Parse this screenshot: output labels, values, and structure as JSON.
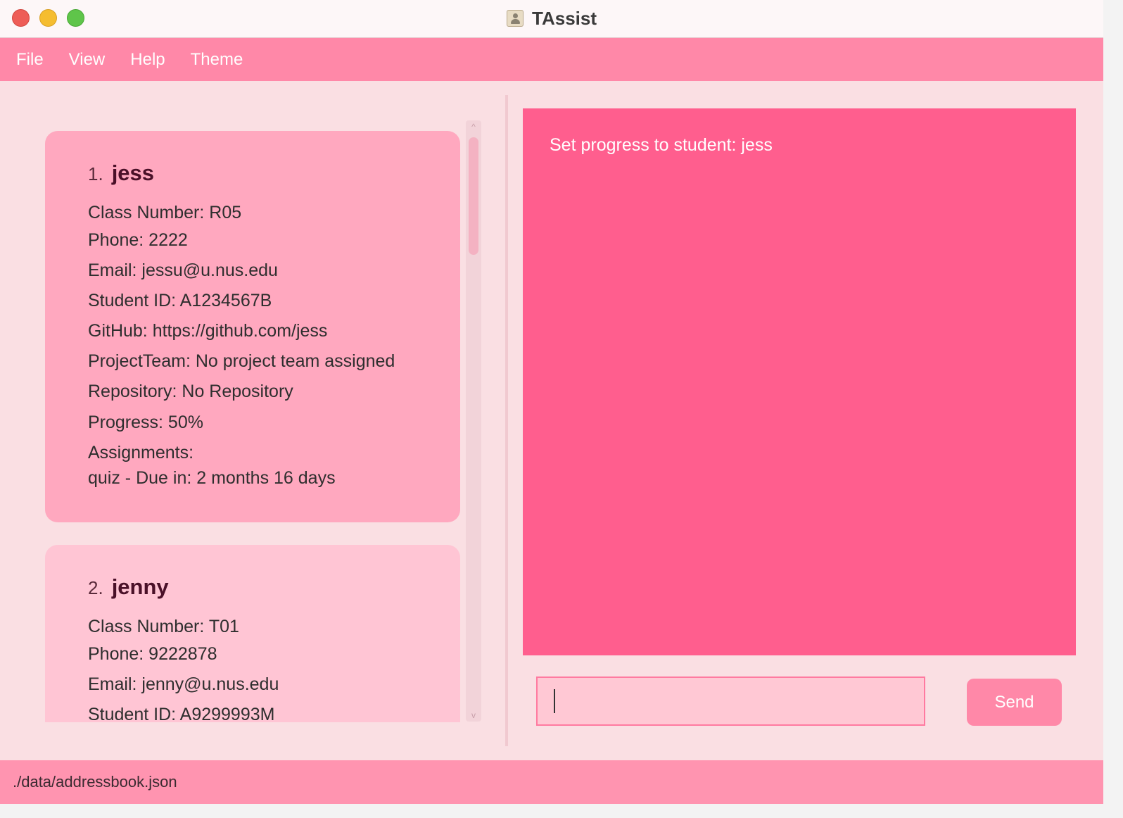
{
  "window": {
    "title": "TAssist"
  },
  "menu": [
    "File",
    "View",
    "Help",
    "Theme"
  ],
  "students": [
    {
      "index": "1.",
      "name": "jess",
      "class_number": "Class Number: R05",
      "phone": "Phone: 2222",
      "email": "Email: jessu@u.nus.edu",
      "student_id": "Student ID: A1234567B",
      "github": "GitHub: https://github.com/jess",
      "project_team": "ProjectTeam: No project team assigned",
      "repository": "Repository: No Repository",
      "progress": "Progress: 50%",
      "assignments_label": "Assignments:",
      "assignment": "quiz - Due in: 2 months 16 days"
    },
    {
      "index": "2.",
      "name": "jenny",
      "class_number": "Class Number: T01",
      "phone": "Phone: 9222878",
      "email": "Email: jenny@u.nus.edu",
      "student_id": "Student ID: A9299993M"
    }
  ],
  "result": {
    "message": "Set progress to student: jess"
  },
  "command": {
    "value": "",
    "placeholder": ""
  },
  "send_label": "Send",
  "status": {
    "path": "./data/addressbook.json"
  },
  "icons": {
    "app": "address-book-icon",
    "scroll_up": "^",
    "scroll_down": "v"
  },
  "colors": {
    "accent": "#ff88a8",
    "result_bg": "#ff5e8e",
    "card_selected": "#ffa8bf",
    "card": "#ffc5d4"
  }
}
